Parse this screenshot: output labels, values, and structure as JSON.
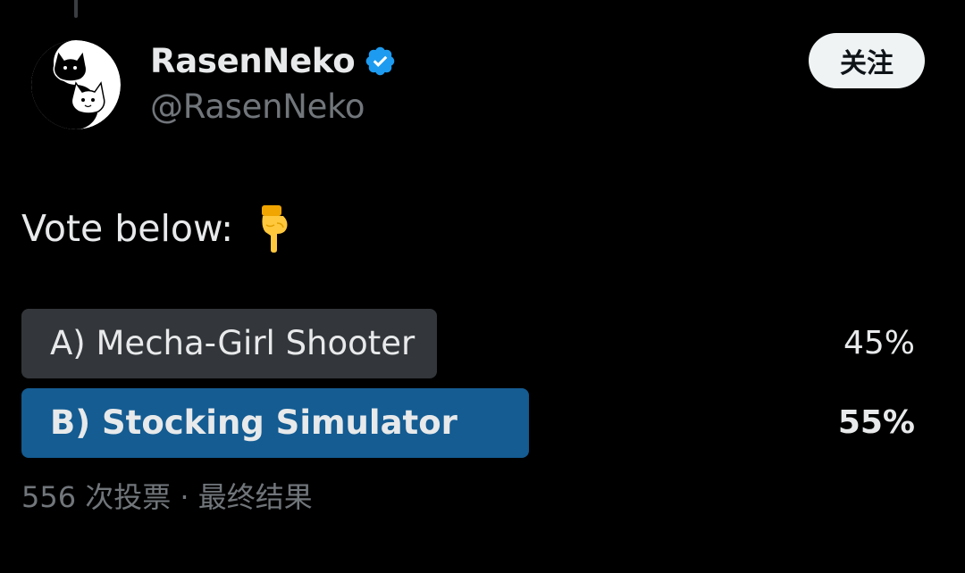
{
  "author": {
    "display_name": "RasenNeko",
    "handle": "@RasenNeko",
    "verified": true,
    "avatar_icon": "yin-yang-cats-avatar"
  },
  "follow_button": {
    "label": "关注"
  },
  "tweet": {
    "text": "Vote below:",
    "emoji_icon": "backhand-index-pointing-down-emoji"
  },
  "poll": {
    "options": [
      {
        "label": "A) Mecha-Girl Shooter",
        "percent_label": "45%",
        "percent": 45,
        "winner": false
      },
      {
        "label": "B) Stocking Simulator",
        "percent_label": "55%",
        "percent": 55,
        "winner": true
      }
    ],
    "footer": "556 次投票 · 最终结果"
  },
  "colors": {
    "background": "#000000",
    "winner_bar": "#145c92",
    "loser_bar": "#33363a",
    "verified_badge": "#1d9bf0",
    "muted_text": "#71767b"
  }
}
